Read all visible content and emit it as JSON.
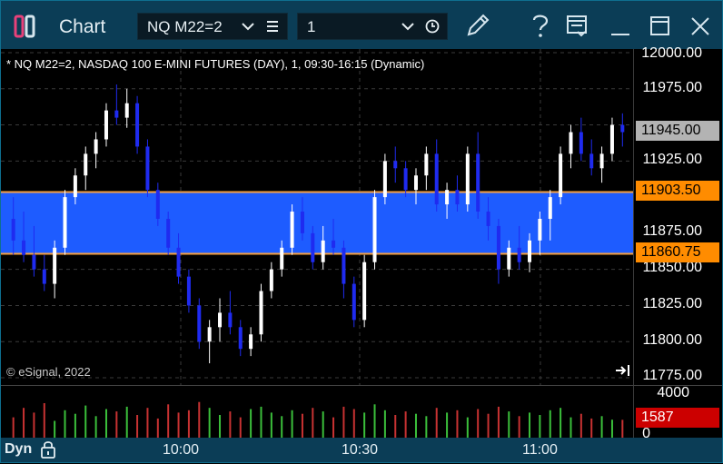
{
  "window": {
    "title": "Chart",
    "symbol_value": "NQ M22=2",
    "interval_value": "1"
  },
  "chart": {
    "header": "* NQ M22=2, NASDAQ 100 E-MINI FUTURES (DAY), 1, 09:30-16:15 (Dynamic)",
    "copyright": "© eSignal, 2022",
    "price_labels": [
      "12000.00",
      "11975.00",
      "11925.00",
      "11875.00",
      "11850.00",
      "11825.00",
      "11800.00",
      "11775.00"
    ],
    "tags": {
      "last_price": "11945.00",
      "band_top": "11903.50",
      "band_bottom": "11860.75",
      "volume_last": "1587"
    },
    "volume_labels": [
      "4000",
      "0"
    ],
    "time_labels": [
      "10:00",
      "10:30",
      "11:00"
    ],
    "mode": "Dyn"
  },
  "colors": {
    "up": "#ffffff",
    "down": "#1f2bf0",
    "band": "#1e5cff",
    "band_edge": "#f5a042",
    "last_tag": "#b3b3b3",
    "band_tag": "#ff8c00",
    "vol_up": "#3bbf3b",
    "vol_down": "#c83232",
    "vol_tag": "#cc0000"
  },
  "chart_data": {
    "type": "candlestick",
    "y_range": [
      11775,
      12000
    ],
    "band": [
      11860.75,
      11903.5
    ],
    "candles": [
      [
        11885,
        11900,
        11860,
        11870
      ],
      [
        11870,
        11890,
        11855,
        11860
      ],
      [
        11860,
        11880,
        11845,
        11850
      ],
      [
        11850,
        11860,
        11835,
        11840
      ],
      [
        11840,
        11870,
        11830,
        11865
      ],
      [
        11865,
        11905,
        11860,
        11900
      ],
      [
        11900,
        11920,
        11895,
        11915
      ],
      [
        11915,
        11935,
        11905,
        11930
      ],
      [
        11930,
        11945,
        11920,
        11940
      ],
      [
        11940,
        11965,
        11935,
        11960
      ],
      [
        11960,
        11978,
        11950,
        11955
      ],
      [
        11955,
        11975,
        11948,
        11965
      ],
      [
        11965,
        11970,
        11930,
        11935
      ],
      [
        11935,
        11940,
        11900,
        11905
      ],
      [
        11905,
        11910,
        11880,
        11885
      ],
      [
        11885,
        11890,
        11860,
        11865
      ],
      [
        11865,
        11875,
        11840,
        11845
      ],
      [
        11845,
        11850,
        11820,
        11825
      ],
      [
        11825,
        11830,
        11795,
        11800
      ],
      [
        11800,
        11815,
        11785,
        11810
      ],
      [
        11810,
        11830,
        11800,
        11820
      ],
      [
        11820,
        11835,
        11805,
        11810
      ],
      [
        11810,
        11815,
        11790,
        11795
      ],
      [
        11795,
        11810,
        11790,
        11805
      ],
      [
        11805,
        11840,
        11800,
        11835
      ],
      [
        11835,
        11855,
        11830,
        11850
      ],
      [
        11850,
        11870,
        11845,
        11865
      ],
      [
        11865,
        11895,
        11860,
        11890
      ],
      [
        11890,
        11900,
        11870,
        11875
      ],
      [
        11875,
        11880,
        11850,
        11855
      ],
      [
        11855,
        11880,
        11850,
        11870
      ],
      [
        11870,
        11885,
        11860,
        11865
      ],
      [
        11865,
        11870,
        11830,
        11840
      ],
      [
        11840,
        11845,
        11810,
        11815
      ],
      [
        11815,
        11860,
        11810,
        11855
      ],
      [
        11855,
        11905,
        11850,
        11900
      ],
      [
        11900,
        11930,
        11895,
        11925
      ],
      [
        11925,
        11935,
        11910,
        11920
      ],
      [
        11920,
        11925,
        11900,
        11905
      ],
      [
        11905,
        11920,
        11895,
        11915
      ],
      [
        11915,
        11935,
        11905,
        11930
      ],
      [
        11930,
        11940,
        11890,
        11895
      ],
      [
        11895,
        11910,
        11885,
        11905
      ],
      [
        11905,
        11915,
        11890,
        11895
      ],
      [
        11895,
        11935,
        11890,
        11930
      ],
      [
        11930,
        11945,
        11885,
        11890
      ],
      [
        11890,
        11900,
        11870,
        11880
      ],
      [
        11880,
        11885,
        11840,
        11850
      ],
      [
        11850,
        11870,
        11845,
        11865
      ],
      [
        11865,
        11880,
        11850,
        11855
      ],
      [
        11855,
        11875,
        11848,
        11870
      ],
      [
        11870,
        11890,
        11860,
        11885
      ],
      [
        11885,
        11905,
        11870,
        11900
      ],
      [
        11900,
        11935,
        11895,
        11930
      ],
      [
        11930,
        11950,
        11920,
        11945
      ],
      [
        11945,
        11955,
        11925,
        11930
      ],
      [
        11930,
        11940,
        11915,
        11920
      ],
      [
        11920,
        11935,
        11910,
        11930
      ],
      [
        11930,
        11955,
        11925,
        11950
      ],
      [
        11950,
        11958,
        11935,
        11945
      ]
    ],
    "volume_max": 4000,
    "volume": [
      1800,
      2600,
      2200,
      3000,
      1500,
      2400,
      2100,
      2800,
      1900,
      2500,
      2300,
      2700,
      2000,
      2600,
      1700,
      2900,
      2200,
      2400,
      3100,
      2600,
      2000,
      2300,
      1800,
      2500,
      2700,
      2200,
      1900,
      2400,
      2100,
      2600,
      2300,
      1800,
      2700,
      2500,
      2200,
      2900,
      2400,
      2000,
      2300,
      2100,
      1900,
      2600,
      2200,
      2400,
      1800,
      2500,
      2100,
      2700,
      2300,
      1900,
      2200,
      2000,
      2400,
      2600,
      1800,
      2100,
      1700,
      1900,
      1600,
      1587
    ]
  }
}
